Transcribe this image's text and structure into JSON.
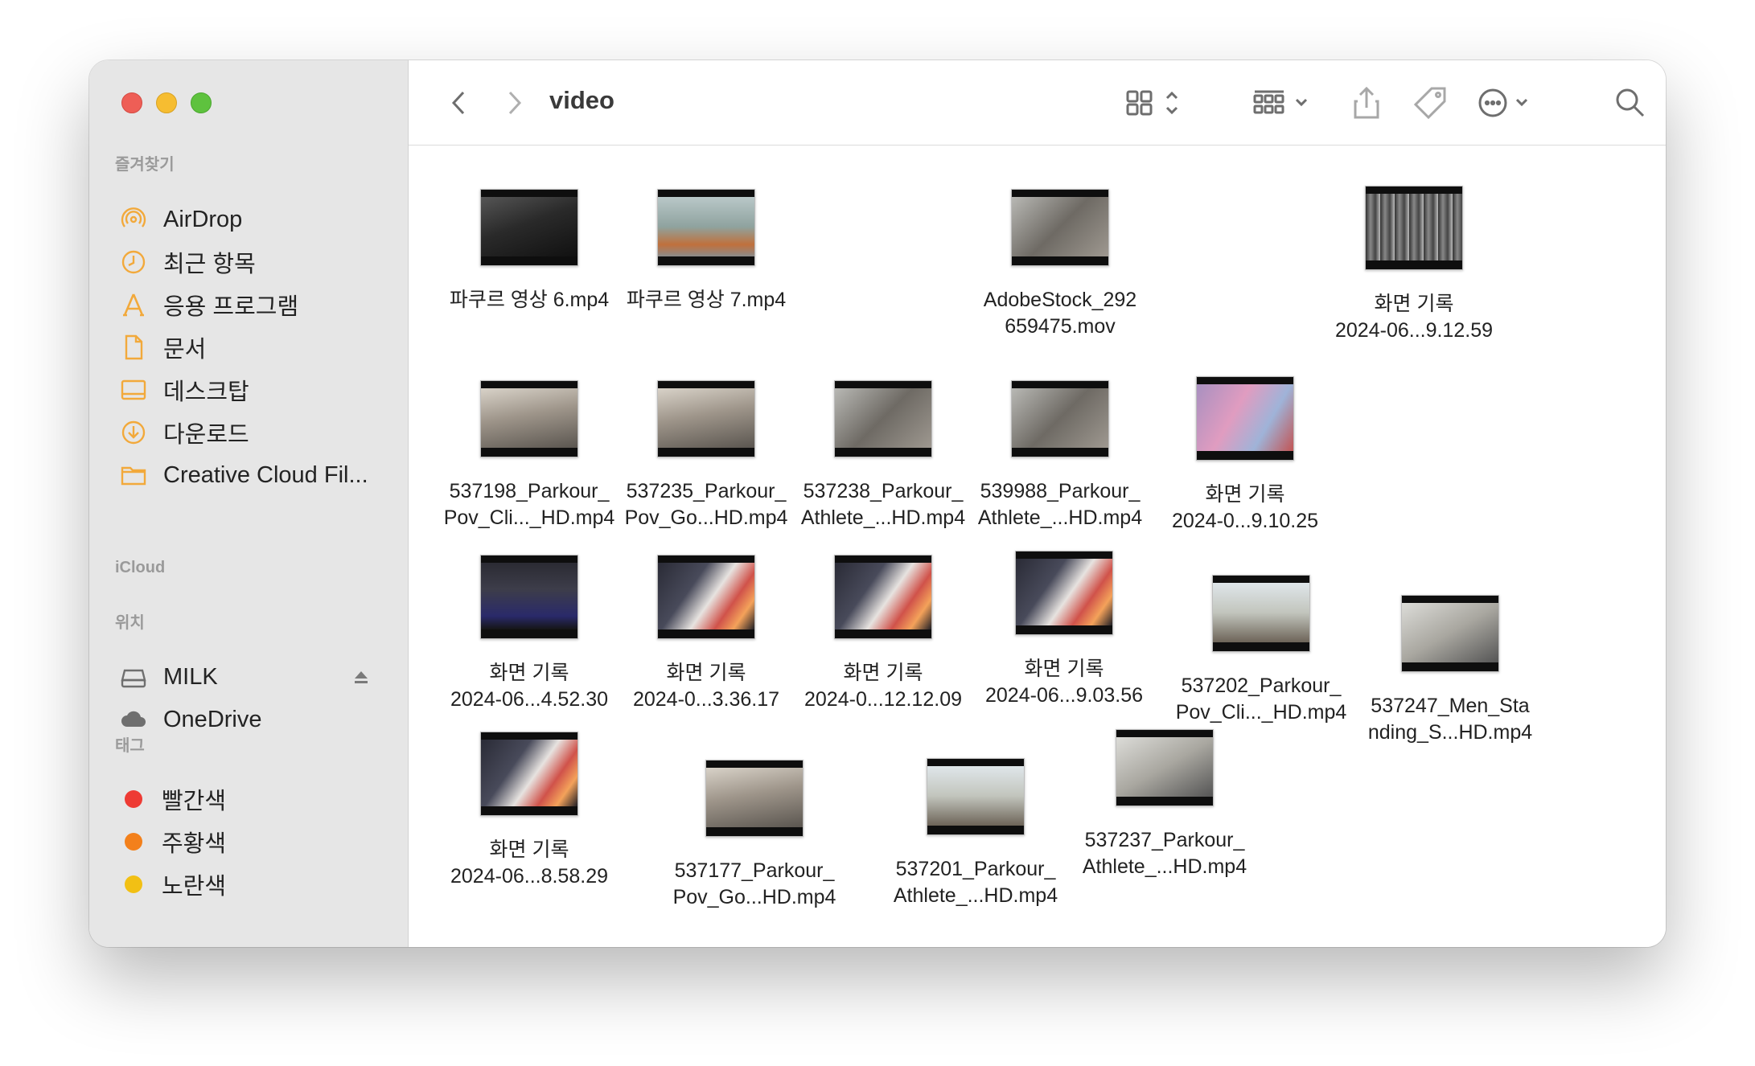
{
  "window": {
    "title": "video"
  },
  "sidebar": {
    "favorites_header": "즐겨찾기",
    "favorites": [
      {
        "label": "AirDrop",
        "icon": "airdrop-icon"
      },
      {
        "label": "최근 항목",
        "icon": "clock-icon"
      },
      {
        "label": "응용 프로그램",
        "icon": "applications-icon"
      },
      {
        "label": "문서",
        "icon": "document-icon"
      },
      {
        "label": "데스크탑",
        "icon": "desktop-icon"
      },
      {
        "label": "다운로드",
        "icon": "download-icon"
      },
      {
        "label": "Creative Cloud Fil...",
        "icon": "folder-icon"
      }
    ],
    "icloud_header": "iCloud",
    "locations_header": "위치",
    "locations": [
      {
        "label": "MILK",
        "icon": "drive-icon"
      },
      {
        "label": "OneDrive",
        "icon": "cloud-icon"
      }
    ],
    "tags_header": "태그",
    "tags": [
      {
        "label": "빨간색",
        "color": "#ee3b34"
      },
      {
        "label": "주황색",
        "color": "#f3801b"
      },
      {
        "label": "노란색",
        "color": "#f2c014"
      }
    ]
  },
  "files": [
    {
      "line1": "파쿠르 영상 6.mp4",
      "line2": "",
      "scene": "dark"
    },
    {
      "line1": "파쿠르 영상 7.mp4",
      "line2": "",
      "scene": "stairs"
    },
    {
      "line1": "AdobeStock_292",
      "line2": "659475.mov",
      "scene": "roof"
    },
    {
      "line1": "화면 기록",
      "line2": "2024-06...9.12.59",
      "scene": "bw"
    },
    {
      "line1": "537198_Parkour_",
      "line2": "Pov_Cli..._HD.mp4",
      "scene": "sand"
    },
    {
      "line1": "537235_Parkour_",
      "line2": "Pov_Go...HD.mp4",
      "scene": "sand"
    },
    {
      "line1": "537238_Parkour_",
      "line2": "Athlete_...HD.mp4",
      "scene": "roof"
    },
    {
      "line1": "539988_Parkour_",
      "line2": "Athlete_...HD.mp4",
      "scene": "roof"
    },
    {
      "line1": "화면 기록",
      "line2": "2024-0...9.10.25",
      "scene": "purple"
    },
    {
      "line1": "화면 기록",
      "line2": "2024-06...4.52.30",
      "scene": "screen"
    },
    {
      "line1": "화면 기록",
      "line2": "2024-0...3.36.17",
      "scene": "desktop"
    },
    {
      "line1": "화면 기록",
      "line2": "2024-0...12.12.09",
      "scene": "desktop"
    },
    {
      "line1": "화면 기록",
      "line2": "2024-06...9.03.56",
      "scene": "desktop"
    },
    {
      "line1": "537202_Parkour_",
      "line2": "Pov_Cli..._HD.mp4",
      "scene": "sky"
    },
    {
      "line1": "537247_Men_Sta",
      "line2": "nding_S...HD.mp4",
      "scene": "room"
    },
    {
      "line1": "화면 기록",
      "line2": "2024-06...8.58.29",
      "scene": "desktop"
    },
    {
      "line1": "537177_Parkour_",
      "line2": "Pov_Go...HD.mp4",
      "scene": "sand"
    },
    {
      "line1": "537201_Parkour_",
      "line2": "Athlete_...HD.mp4",
      "scene": "sky"
    },
    {
      "line1": "537237_Parkour_",
      "line2": "Athlete_...HD.mp4",
      "scene": "room"
    }
  ],
  "colors": {
    "accent": "#f2a93b",
    "sidebar_bg": "#e6e6e6"
  }
}
